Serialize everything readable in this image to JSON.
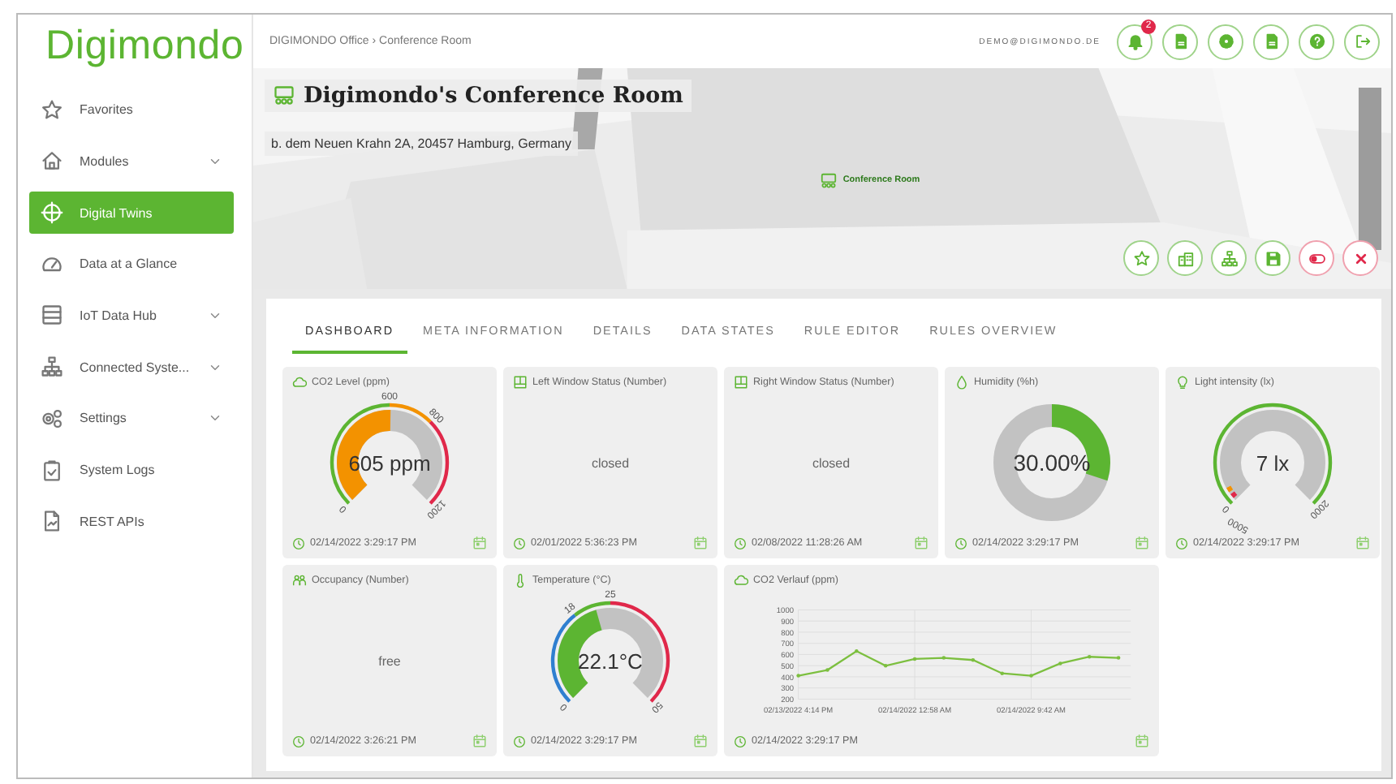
{
  "sidebar": {
    "logo": "Digimondo",
    "items": [
      {
        "label": "Favorites",
        "selected": false,
        "expandable": false
      },
      {
        "label": "Modules",
        "selected": false,
        "expandable": true
      },
      {
        "label": "Digital Twins",
        "selected": true,
        "expandable": false
      },
      {
        "label": "Data at a Glance",
        "selected": false,
        "expandable": false
      },
      {
        "label": "IoT Data Hub",
        "selected": false,
        "expandable": true
      },
      {
        "label": "Connected Syste...",
        "selected": false,
        "expandable": true
      },
      {
        "label": "Settings",
        "selected": false,
        "expandable": true
      },
      {
        "label": "System Logs",
        "selected": false,
        "expandable": false
      },
      {
        "label": "REST APIs",
        "selected": false,
        "expandable": false
      }
    ]
  },
  "header": {
    "breadcrumb": "DIGIMONDO Office › Conference Room",
    "user": "DEMO@DIGIMONDO.DE",
    "notification_count": "2"
  },
  "hero": {
    "title": "Digimondo's Conference Room",
    "address": "b. dem Neuen Krahn 2A, 20457 Hamburg, Germany",
    "marker_label": "Conference Room"
  },
  "tabs": [
    {
      "label": "DASHBOARD",
      "selected": true
    },
    {
      "label": "META INFORMATION",
      "selected": false
    },
    {
      "label": "DETAILS",
      "selected": false
    },
    {
      "label": "DATA STATES",
      "selected": false
    },
    {
      "label": "RULE EDITOR",
      "selected": false
    },
    {
      "label": "RULES OVERVIEW",
      "selected": false
    }
  ],
  "tiles": [
    {
      "kind": "gauge",
      "title": "CO2 Level (ppm)",
      "value": "605 ppm",
      "color": "#f39200",
      "bands": [
        {
          "color": "#5cb532"
        },
        {
          "color": "#f39200"
        },
        {
          "color": "#e0284a"
        }
      ],
      "ticks": [
        "0",
        "600",
        "800",
        "1200"
      ],
      "timestamp": "02/14/2022 3:29:17 PM"
    },
    {
      "kind": "text",
      "title": "Left Window Status (Number)",
      "value": "closed",
      "timestamp": "02/01/2022 5:36:23 PM"
    },
    {
      "kind": "text",
      "title": "Right Window Status (Number)",
      "value": "closed",
      "timestamp": "02/08/2022 11:28:26 AM"
    },
    {
      "kind": "donut",
      "title": "Humidity (%h)",
      "value": "30.00%",
      "color": "#5cb532",
      "timestamp": "02/14/2022 3:29:17 PM"
    },
    {
      "kind": "gauge",
      "title": "Light intensity (lx)",
      "value": "7 lx",
      "color": "#c4c4c4",
      "bands": [
        {
          "color": "#5cb532"
        }
      ],
      "marks": [
        {
          "color": "#e0284a"
        },
        {
          "color": "#f39200"
        }
      ],
      "ticks": [
        "0",
        "2000"
      ],
      "threshold_label": "5000",
      "timestamp": "02/14/2022 3:29:17 PM"
    },
    {
      "kind": "text",
      "title": "Occupancy (Number)",
      "value": "free",
      "timestamp": "02/14/2022 3:26:21 PM"
    },
    {
      "kind": "gauge",
      "title": "Temperature (°C)",
      "value": "22.1°C",
      "color": "#5cb532",
      "bands": [
        {
          "color": "#2f7fd0"
        },
        {
          "color": "#5cb532"
        },
        {
          "color": "#e0284a"
        }
      ],
      "ticks": [
        "0",
        "18",
        "25",
        "50"
      ],
      "timestamp": "02/14/2022 3:29:17 PM"
    },
    {
      "kind": "chart",
      "title": "CO2 Verlauf (ppm)",
      "timestamp": "02/14/2022 3:29:17 PM",
      "chart_data": {
        "type": "line",
        "categories": [
          "02/13/2022 4:14 PM",
          null,
          null,
          null,
          "02/14/2022 12:58 AM",
          null,
          null,
          null,
          "02/14/2022 9:42 AM",
          null,
          null,
          null
        ],
        "series": [
          {
            "color": "#7cbf3f",
            "values": [
              410,
              460,
              630,
              500,
              560,
              570,
              550,
              430,
              410,
              520,
              580,
              570
            ]
          }
        ],
        "grid": true,
        "ylim": [
          200,
          1000
        ],
        "yticks": [
          200,
          300,
          400,
          500,
          600,
          700,
          800,
          900,
          1000
        ]
      }
    }
  ]
}
